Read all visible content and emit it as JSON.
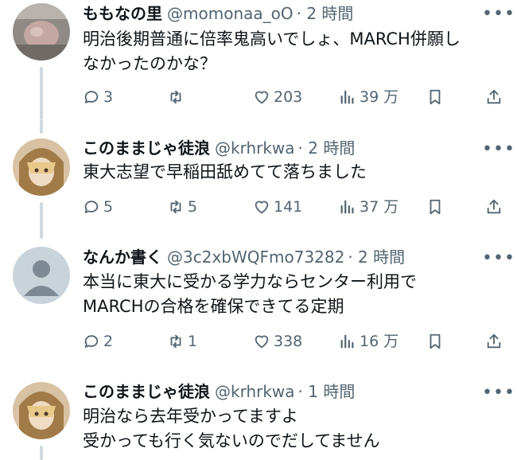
{
  "tweets": [
    {
      "name": "ももなの里",
      "handle": "@momonaa_oO",
      "time": "· 2 時間",
      "lines": [
        "明治後期普通に倍率鬼高いでしょ、MARCH併願し",
        "なかったのかな？"
      ],
      "replies": "3",
      "retweets": "",
      "likes": "203",
      "views": "39 万",
      "avatar_color": "#a89a96"
    },
    {
      "name": "このままじゃ徒浪",
      "handle": "@krhrkwa",
      "time": "· 2 時間",
      "lines": [
        "東大志望で早稲田舐めてて落ちました"
      ],
      "replies": "5",
      "retweets": "5",
      "likes": "141",
      "views": "37 万",
      "avatar_color": "#9b7a52"
    },
    {
      "name": "なんか書く",
      "handle": "@3c2xbWQFmo73282",
      "time": "· 2 時間",
      "lines": [
        "本当に東大に受かる学力ならセンター利用で",
        "MARCHの合格を確保できてる定期"
      ],
      "replies": "2",
      "retweets": "1",
      "likes": "338",
      "views": "16 万",
      "avatar_color": "#c9d3da"
    },
    {
      "name": "このままじゃ徒浪",
      "handle": "@krhrkwa",
      "time": "· 1 時間",
      "lines": [
        "明治なら去年受かってますよ",
        "受かっても行く気ないのでだしてません"
      ],
      "avatar_color": "#9b7a52"
    }
  ],
  "icons": {
    "reply": "reply-icon",
    "retweet": "retweet-icon",
    "like": "heart-icon",
    "views": "views-icon",
    "bookmark": "bookmark-icon",
    "share": "share-icon",
    "more": "more-icon"
  },
  "more_label": "•••"
}
